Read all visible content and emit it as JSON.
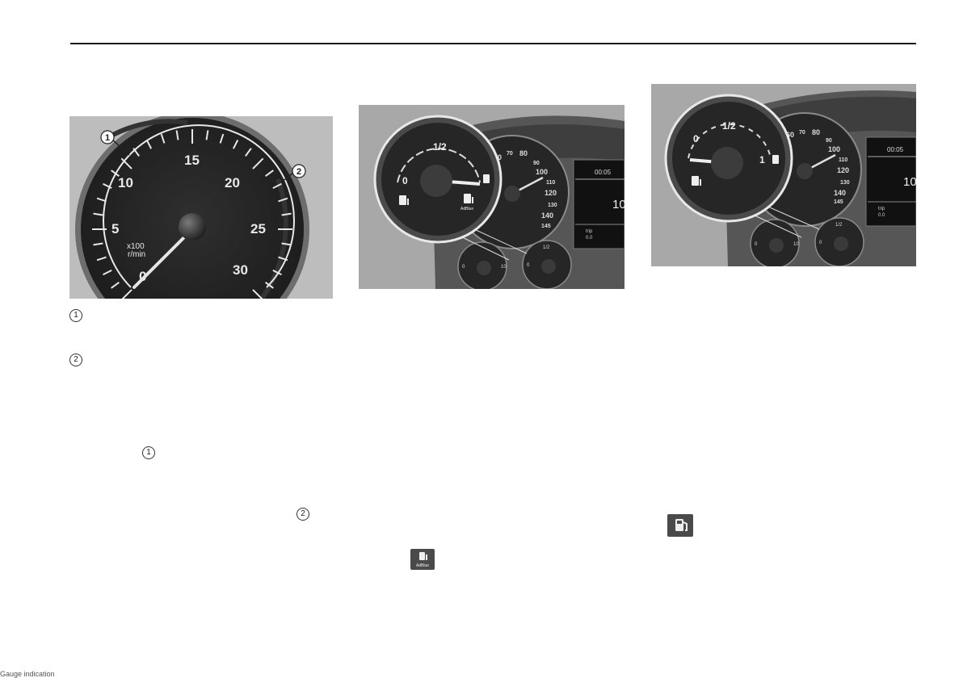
{
  "tachometer": {
    "ticks": [
      "0",
      "5",
      "10",
      "15",
      "20",
      "25",
      "30"
    ],
    "unit_line1": "x100",
    "unit_line2": "r/min",
    "callout_1": "1",
    "callout_2": "2"
  },
  "legend": {
    "item_1": "1",
    "item_2": "2"
  },
  "body_refs": {
    "ref_1": "1",
    "ref_2": "2"
  },
  "adblue_cluster": {
    "zoom_labels": [
      "0",
      "1/2"
    ],
    "speed_labels": [
      "60",
      "70",
      "80",
      "90",
      "100",
      "110",
      "120",
      "130",
      "140",
      "145"
    ],
    "clock": "00:05",
    "big_value": "10",
    "trip_label": "trip",
    "trip_value": "0.0",
    "small_gauge_left": [
      "0",
      "10"
    ],
    "small_gauge_right": [
      "0",
      "1/2"
    ],
    "adblue_text": "AdBlue"
  },
  "fuel_cluster": {
    "zoom_labels": [
      "0",
      "1/2",
      "1"
    ],
    "speed_labels": [
      "60",
      "70",
      "80",
      "90",
      "100",
      "110",
      "120",
      "130",
      "140",
      "145"
    ],
    "clock": "00:05",
    "big_value": "10",
    "trip_label": "trip",
    "trip_value": "0.0",
    "small_gauge_left": [
      "0",
      "10"
    ],
    "small_gauge_right": [
      "0",
      "1/2"
    ]
  },
  "adblue_icon_text": "AdBlue",
  "footer_text": "Gauge indication"
}
